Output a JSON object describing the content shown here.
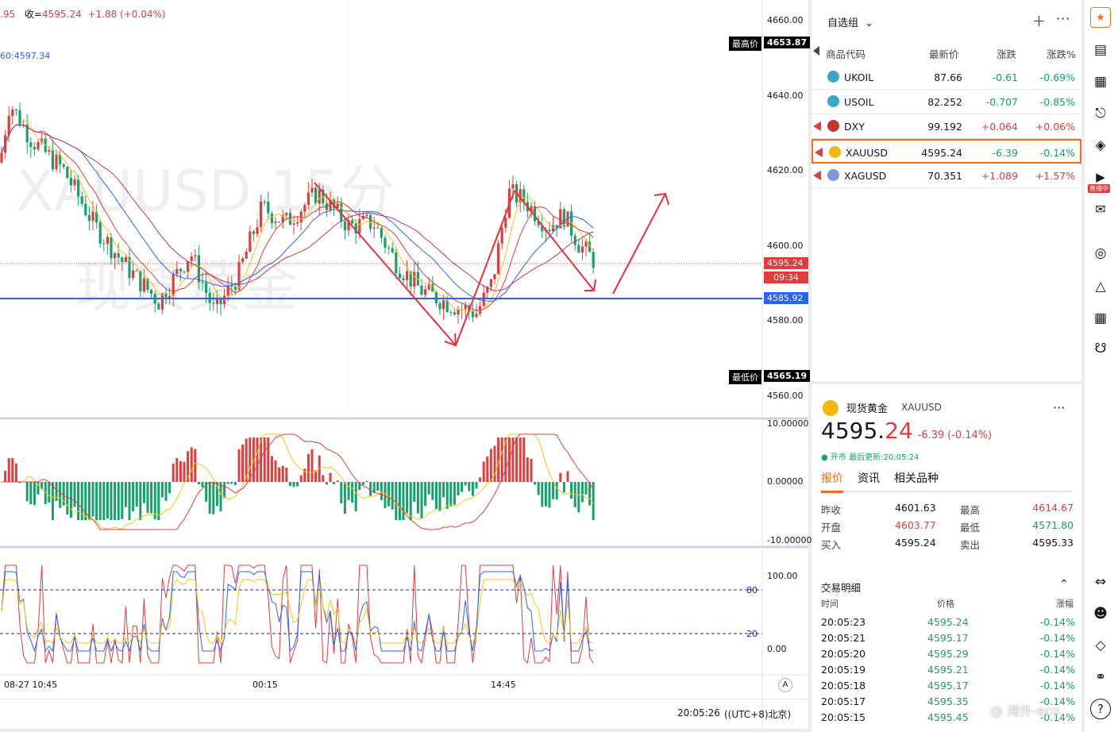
{
  "header": {
    "partial_prefix": ".95",
    "close_label": "收=",
    "close_value": "4595.24",
    "change": "+1.88",
    "change_pct": "(+0.04%)",
    "ma_label": "60:4597.34"
  },
  "watermark": {
    "line1": "XAUUSD,15分",
    "line2": "现货黄金"
  },
  "price_axis": [
    "4660.00",
    "4640.00",
    "4620.00",
    "4600.00",
    "4580.00",
    "4560.00"
  ],
  "tags": {
    "high_label": "最高价",
    "high_value": "4653.87",
    "low_label": "最低价",
    "low_value": "4565.19",
    "last_price": "4595.24",
    "countdown": "09:34",
    "hline": "4585.92"
  },
  "macd_axis": [
    "10.00000",
    "0.00000",
    "-10.00000"
  ],
  "kdj_axis": [
    "100.00",
    "0.00"
  ],
  "kdj_levels": [
    "80",
    "20"
  ],
  "time_axis": [
    "08-27 10:45",
    "00:15",
    "14:45"
  ],
  "footer": {
    "time": "20:05:26",
    "tz": "((UTC+8)北京)",
    "auto": "A"
  },
  "watchlist": {
    "group": "自选组",
    "cols": [
      "商品代码",
      "最新价",
      "涨跌",
      "涨跌%"
    ],
    "rows": [
      {
        "sym": "UKOIL",
        "price": "87.66",
        "chg": "-0.61",
        "pct": "-0.69%",
        "dir": "down",
        "flag": false
      },
      {
        "sym": "USOIL",
        "price": "82.252",
        "chg": "-0.707",
        "pct": "-0.85%",
        "dir": "down",
        "flag": false
      },
      {
        "sym": "DXY",
        "price": "99.192",
        "chg": "+0.064",
        "pct": "+0.06%",
        "dir": "up",
        "flag": true
      },
      {
        "sym": "XAUUSD",
        "price": "4595.24",
        "chg": "-6.39",
        "pct": "-0.14%",
        "dir": "down",
        "flag": true
      },
      {
        "sym": "XAGUSD",
        "price": "70.351",
        "chg": "+1.089",
        "pct": "+1.57%",
        "dir": "up",
        "flag": true
      }
    ]
  },
  "detail": {
    "name": "现货黄金",
    "symbol": "XAUUSD",
    "price_main": "4595.",
    "price_dec": "24",
    "change": "-6.39",
    "change_pct": "(-0.14%)",
    "status": "开市",
    "updated_label": "最后更新:20:05:24",
    "tabs": [
      "报价",
      "资讯",
      "相关品种"
    ],
    "stats": [
      {
        "k": "昨收",
        "v": "4601.63",
        "k2": "最高",
        "v2": "4614.67"
      },
      {
        "k": "开盘",
        "v": "4603.77",
        "k2": "最低",
        "v2": "4571.80"
      },
      {
        "k": "买入",
        "v": "4595.24",
        "k2": "卖出",
        "v2": "4595.33"
      }
    ],
    "trades_title": "交易明细",
    "trade_cols": [
      "时间",
      "价格",
      "涨幅"
    ],
    "trades": [
      {
        "t": "20:05:23",
        "p": "4595.24",
        "c": "-0.14%"
      },
      {
        "t": "20:05:21",
        "p": "4595.17",
        "c": "-0.14%"
      },
      {
        "t": "20:05:20",
        "p": "4595.29",
        "c": "-0.14%"
      },
      {
        "t": "20:05:19",
        "p": "4595.21",
        "c": "-0.14%"
      },
      {
        "t": "20:05:18",
        "p": "4595.17",
        "c": "-0.14%"
      },
      {
        "t": "20:05:17",
        "p": "4595.35",
        "c": "-0.14%"
      },
      {
        "t": "20:05:15",
        "p": "4595.45",
        "c": "-0.14%"
      }
    ]
  },
  "live_badge": "直播中",
  "corner_watermark": "@ 海外-eco",
  "colors": {
    "up": "#e23c3c",
    "down": "#14a26b",
    "accent": "#f26d21",
    "line": "#2962ff"
  }
}
